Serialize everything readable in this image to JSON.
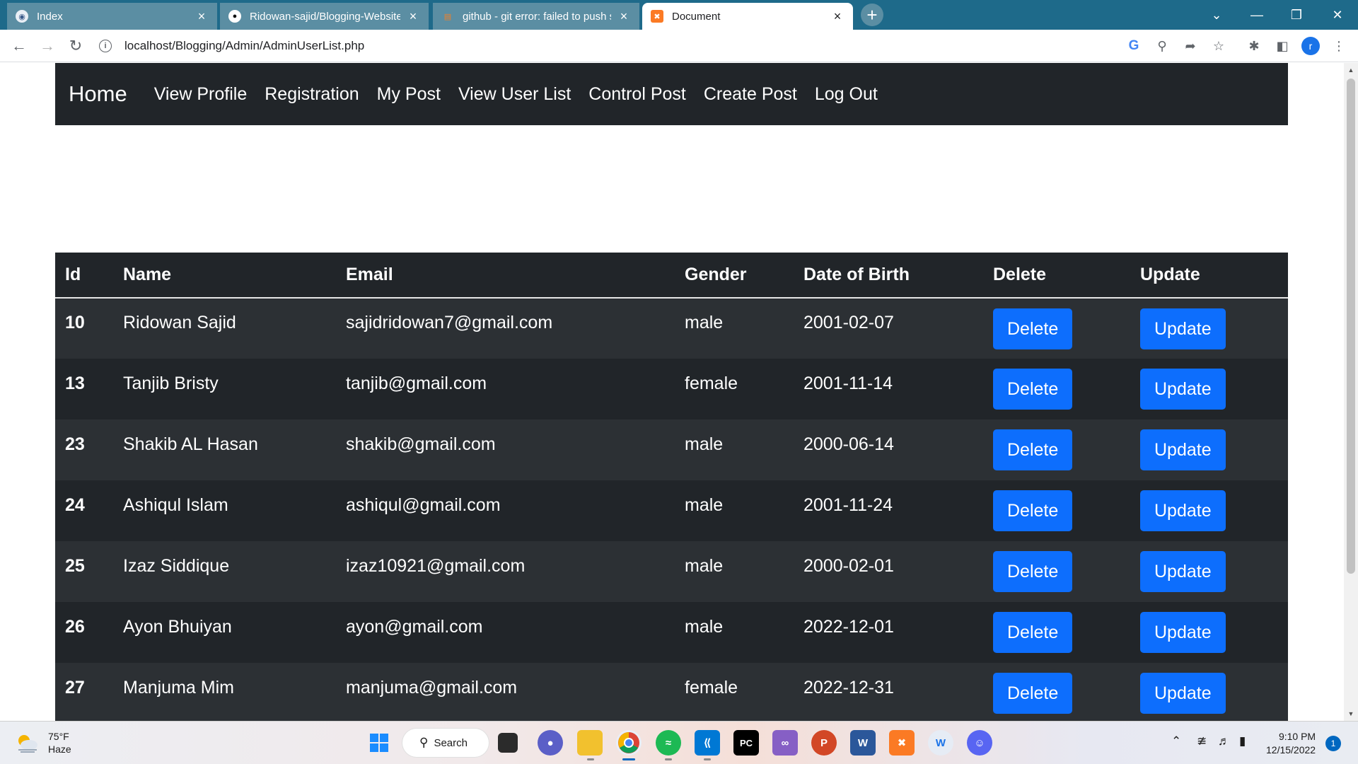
{
  "browser": {
    "tabs": [
      {
        "title": "Index",
        "favicon": "globe-icon"
      },
      {
        "title": "Ridowan-sajid/Blogging-Website",
        "favicon": "github-icon"
      },
      {
        "title": "github - git error: failed to push so",
        "favicon": "stackoverflow-icon"
      },
      {
        "title": "Document",
        "favicon": "xampp-icon"
      }
    ],
    "active_tab": 3,
    "url": "localhost/Blogging/Admin/AdminUserList.php",
    "profile_initial": "r"
  },
  "navbar": {
    "brand": "Home",
    "links": [
      "View Profile",
      "Registration",
      "My Post",
      "View User List",
      "Control Post",
      "Create Post",
      "Log Out"
    ]
  },
  "table": {
    "headers": [
      "Id",
      "Name",
      "Email",
      "Gender",
      "Date of Birth",
      "Delete",
      "Update"
    ],
    "delete_label": "Delete",
    "update_label": "Update",
    "rows": [
      {
        "id": "10",
        "name": "Ridowan Sajid",
        "email": "sajidridowan7@gmail.com",
        "gender": "male",
        "dob": "2001-02-07"
      },
      {
        "id": "13",
        "name": "Tanjib Bristy",
        "email": "tanjib@gmail.com",
        "gender": "female",
        "dob": "2001-11-14"
      },
      {
        "id": "23",
        "name": "Shakib AL Hasan",
        "email": "shakib@gmail.com",
        "gender": "male",
        "dob": "2000-06-14"
      },
      {
        "id": "24",
        "name": "Ashiqul Islam",
        "email": "ashiqul@gmail.com",
        "gender": "male",
        "dob": "2001-11-24"
      },
      {
        "id": "25",
        "name": "Izaz Siddique",
        "email": "izaz10921@gmail.com",
        "gender": "male",
        "dob": "2000-02-01"
      },
      {
        "id": "26",
        "name": "Ayon Bhuiyan",
        "email": "ayon@gmail.com",
        "gender": "male",
        "dob": "2022-12-01"
      },
      {
        "id": "27",
        "name": "Manjuma Mim",
        "email": "manjuma@gmail.com",
        "gender": "female",
        "dob": "2022-12-31"
      }
    ]
  },
  "taskbar": {
    "weather_temp": "75°F",
    "weather_cond": "Haze",
    "search_label": "Search",
    "time": "9:10 PM",
    "date": "12/15/2022",
    "notification_count": "1"
  },
  "colors": {
    "tabstrip": "#1e6a8a",
    "navbar": "#212529",
    "table_dark": "#212529",
    "table_stripe": "#2c3034",
    "button_primary": "#0d6efd"
  }
}
